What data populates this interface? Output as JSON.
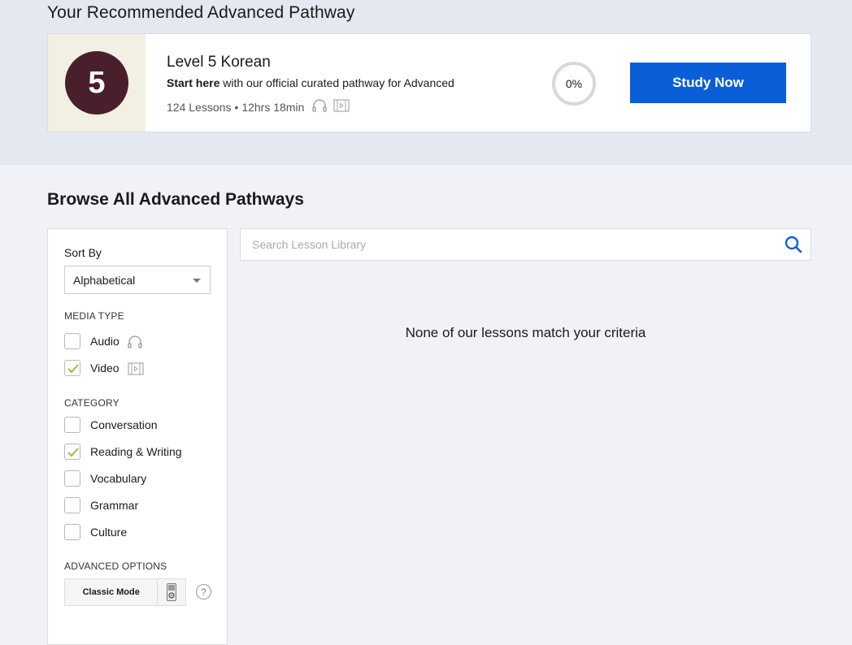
{
  "recommended": {
    "title": "Your Recommended Advanced Pathway",
    "level_number": "5",
    "name": "Level 5 Korean",
    "desc_bold": "Start here",
    "desc_rest": " with our official curated pathway for Advanced",
    "lessons": "124 Lessons",
    "separator": "•",
    "duration": "12hrs 18min",
    "progress_text": "0%",
    "progress_fraction": 0,
    "study_label": "Study Now",
    "study_color": "#0a5fd8",
    "thumb_color": "#4a1f2c",
    "icons": [
      "headphones-icon",
      "video-film-icon"
    ]
  },
  "browse": {
    "title": "Browse All Advanced Pathways",
    "empty_message": "None of our lessons match your criteria"
  },
  "search": {
    "placeholder": "Search Lesson Library",
    "value": "",
    "icon": "search-icon"
  },
  "filters": {
    "sort_label": "Sort By",
    "sort_value": "Alphabetical",
    "media_type_heading": "MEDIA TYPE",
    "media_types": [
      {
        "label": "Audio",
        "checked": false,
        "icon": "headphones-icon"
      },
      {
        "label": "Video",
        "checked": true,
        "icon": "video-film-icon"
      }
    ],
    "category_heading": "CATEGORY",
    "categories": [
      {
        "label": "Conversation",
        "checked": false
      },
      {
        "label": "Reading & Writing",
        "checked": true
      },
      {
        "label": "Vocabulary",
        "checked": false
      },
      {
        "label": "Grammar",
        "checked": false
      },
      {
        "label": "Culture",
        "checked": false
      }
    ],
    "advanced_heading": "ADVANCED OPTIONS",
    "classic_mode_label": "Classic Mode",
    "help_symbol": "?",
    "check_color": "#8cc63f"
  }
}
